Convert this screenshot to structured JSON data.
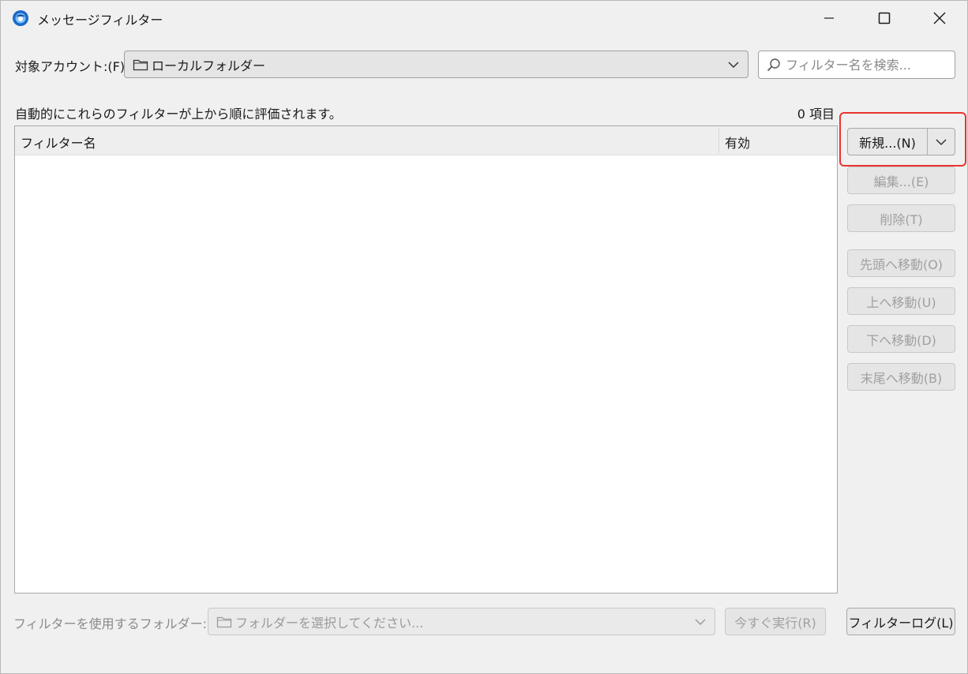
{
  "window": {
    "title": "メッセージフィルター",
    "app_icon": "thunderbird-icon",
    "controls": [
      "minimize-icon",
      "maximize-icon",
      "close-icon"
    ]
  },
  "account": {
    "label": "対象アカウント:(F)",
    "selected": "ローカルフォルダー",
    "icon": "folder-icon"
  },
  "search": {
    "placeholder": "フィルター名を検索..."
  },
  "list": {
    "description": "自動的にこれらのフィルターが上から順に評価されます。",
    "count": "0 項目",
    "columns": [
      "フィルター名",
      "有効"
    ],
    "rows": []
  },
  "buttons": {
    "new": "新規...(N)",
    "edit": "編集...(E)",
    "delete": "削除(T)",
    "move_top": "先頭へ移動(O)",
    "move_up": "上へ移動(U)",
    "move_down": "下へ移動(D)",
    "move_bottom": "末尾へ移動(B)"
  },
  "bottom": {
    "apply_label": "フィルターを使用するフォルダー:(C)",
    "folder_placeholder": "フォルダーを選択してください...",
    "run_now": "今すぐ実行(R)",
    "filter_log": "フィルターログ(L)"
  },
  "colors": {
    "highlight": "#e8352e",
    "background": "#f0f0f0",
    "disabled_text": "#a0a0a0"
  }
}
